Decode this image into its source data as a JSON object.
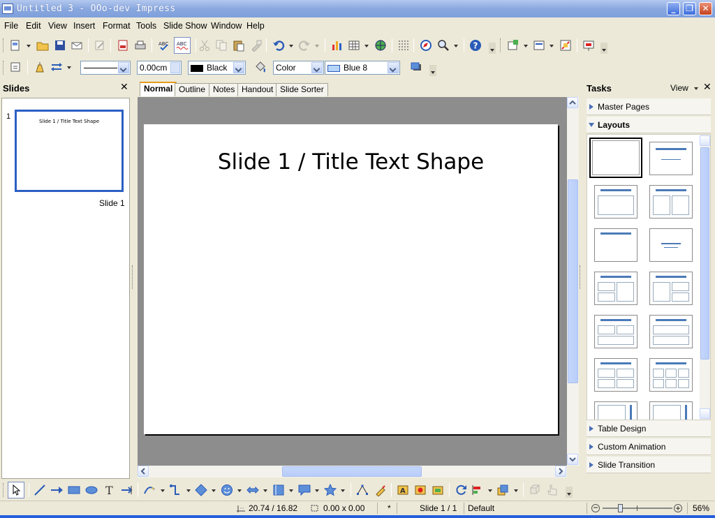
{
  "window": {
    "title": "Untitled 3 - OOo-dev Impress"
  },
  "menu": [
    "File",
    "Edit",
    "View",
    "Insert",
    "Format",
    "Tools",
    "Slide Show",
    "Window",
    "Help"
  ],
  "line_toolbar": {
    "line_width": "0.00cm",
    "line_color": "Black",
    "area_style": "Color",
    "area_color": "Blue 8"
  },
  "slides_panel": {
    "title": "Slides",
    "thumb_number": "1",
    "thumb_title": "Slide 1 / Title Text Shape",
    "thumb_caption": "Slide 1"
  },
  "view_tabs": [
    "Normal",
    "Outline",
    "Notes",
    "Handout",
    "Slide Sorter"
  ],
  "slide": {
    "title": "Slide 1 / Title Text Shape"
  },
  "tasks": {
    "title": "Tasks",
    "view_label": "View",
    "master_pages": "Master Pages",
    "layouts": "Layouts",
    "table_design": "Table Design",
    "custom_animation": "Custom Animation",
    "slide_transition": "Slide Transition"
  },
  "status": {
    "position": "20.74 / 16.82",
    "size": "0.00 x 0.00",
    "modified": "*",
    "slide": "Slide 1 / 1",
    "master": "Default",
    "zoom": "56%"
  },
  "colors": {
    "titlebar": "#8aa8df",
    "accent": "#4a7ab8",
    "tab_highlight": "#e69a1f"
  }
}
